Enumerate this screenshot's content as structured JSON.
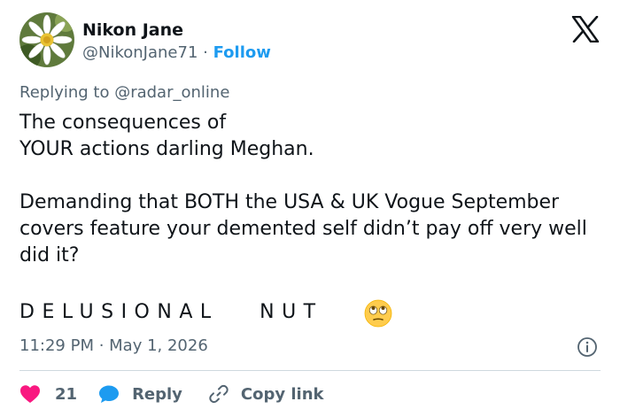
{
  "user": {
    "name": "Nikon Jane",
    "handle": "@NikonJane71",
    "separator": "·",
    "follow_label": "Follow"
  },
  "reply": {
    "prefix": "Replying to ",
    "to": "@radar_online"
  },
  "tweet": {
    "line1": "The consequences of",
    "line2": "YOUR actions darling Meghan.",
    "para2": "Demanding that BOTH the USA & UK Vogue September covers feature your demented self didn’t pay off very well did it?",
    "shout": "DELUSIONAL   NUT",
    "emoji": "face-with-rolling-eyes"
  },
  "meta": {
    "timestamp": "11:29 PM · May 1, 2026"
  },
  "actions": {
    "like_count": "21",
    "reply_label": "Reply",
    "copy_label": "Copy link"
  },
  "colors": {
    "accent": "#1d9bf0",
    "like": "#f91880",
    "secondary_text": "#536471",
    "divider": "#cfd9de"
  }
}
